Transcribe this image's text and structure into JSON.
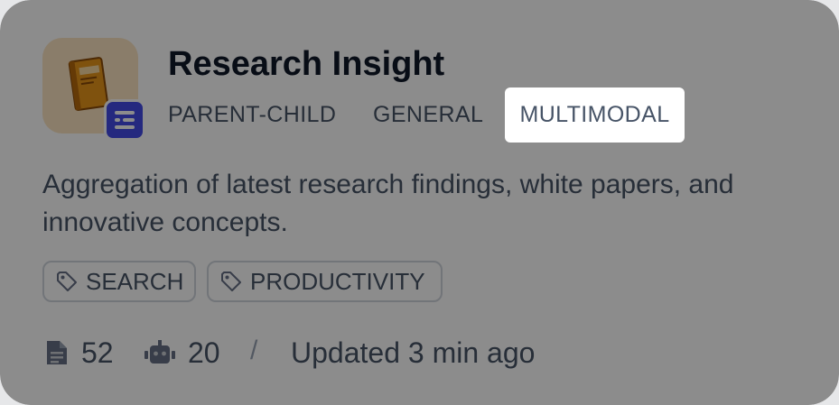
{
  "dataset": {
    "title": "Research Insight",
    "icon": "book-icon",
    "badge_icon": "text-lines-icon",
    "accent": "#444ce7",
    "icon_bg": "#fbe3c2"
  },
  "chunk_modes": [
    {
      "label": "PARENT-CHILD",
      "highlighted": false
    },
    {
      "label": "GENERAL",
      "highlighted": false
    },
    {
      "label": "MULTIMODAL",
      "highlighted": true
    }
  ],
  "description": "Aggregation of latest research findings, white papers, and innovative concepts.",
  "tags": [
    {
      "label": "SEARCH",
      "icon": "tag-icon"
    },
    {
      "label": "PRODUCTIVITY",
      "icon": "tag-icon"
    }
  ],
  "stats": {
    "documents": "52",
    "documents_icon": "document-icon",
    "apps": "20",
    "apps_icon": "robot-icon",
    "separator": "/",
    "updated": "Updated 3 min ago"
  }
}
